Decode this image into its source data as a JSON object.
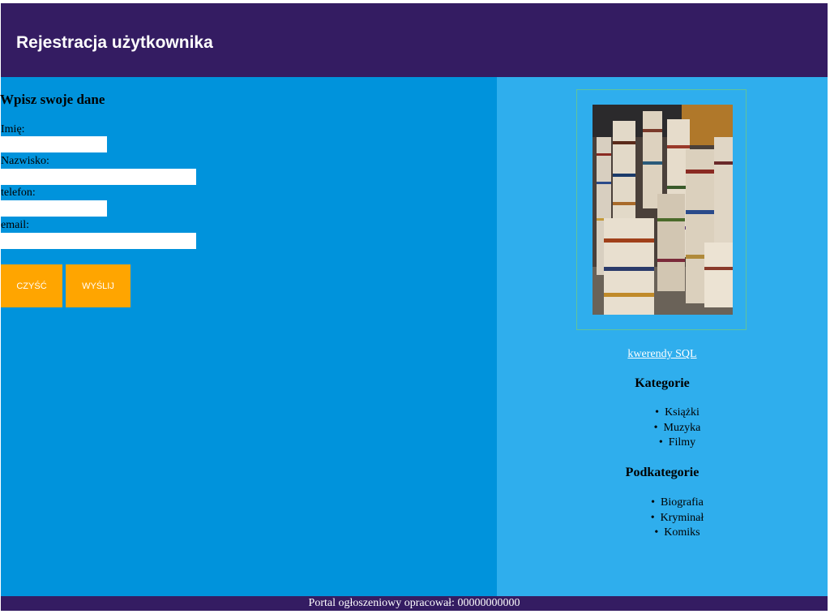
{
  "header": {
    "title": "Rejestracja użytkownika"
  },
  "form": {
    "title": "Wpisz swoje dane",
    "fields": [
      {
        "label": "Imię:",
        "value": ""
      },
      {
        "label": "Nazwisko:",
        "value": ""
      },
      {
        "label": "telefon:",
        "value": ""
      },
      {
        "label": "email:",
        "value": ""
      }
    ],
    "buttons": {
      "clear": "CZYŚĆ",
      "submit": "WYŚLIJ"
    }
  },
  "sidebar": {
    "link": "kwerendy SQL",
    "categories_title": "Kategorie",
    "categories": [
      "Książki",
      "Muzyka",
      "Filmy"
    ],
    "subcategories_title": "Podkategorie",
    "subcategories": [
      "Biografia",
      "Kryminał",
      "Komiks"
    ]
  },
  "footer": {
    "text": "Portal ogłoszeniowy opracował: 00000000000"
  },
  "colors": {
    "header_bg": "#341c62",
    "left_bg": "#0093dc",
    "right_bg": "#2faeed",
    "button_bg": "#ffa500"
  }
}
